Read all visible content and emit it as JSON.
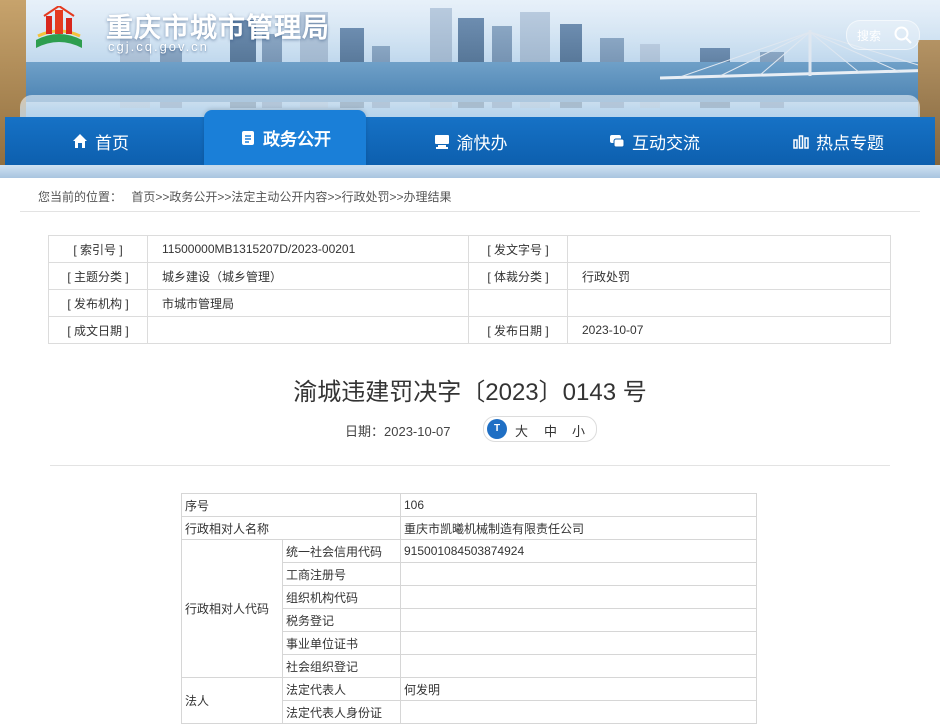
{
  "site": {
    "title": "重庆市城市管理局",
    "url": "cgj.cq.gov.cn",
    "search_label": "搜索"
  },
  "nav": {
    "items": [
      {
        "label": "首页",
        "icon": "home-icon"
      },
      {
        "label": "政务公开",
        "icon": "document-icon",
        "active": true
      },
      {
        "label": "渝快办",
        "icon": "service-desk-icon"
      },
      {
        "label": "互动交流",
        "icon": "chat-icon"
      },
      {
        "label": "热点专题",
        "icon": "topics-icon"
      }
    ]
  },
  "breadcrumb": {
    "prefix": "您当前的位置：",
    "items": [
      "首页",
      "政务公开",
      "法定主动公开内容",
      "行政处罚",
      "办理结果"
    ],
    "separator": ">>"
  },
  "meta": {
    "index_no_label": "[ 索引号 ]",
    "index_no": "11500000MB1315207D/2023-00201",
    "doc_no_label": "[ 发文字号 ]",
    "doc_no": "",
    "topic_label": "[ 主题分类 ]",
    "topic": "城乡建设（城乡管理）",
    "genre_label": "[ 体裁分类 ]",
    "genre": "行政处罚",
    "issuer_label": "[ 发布机构 ]",
    "issuer": "市城市管理局",
    "written_label": "[ 成文日期 ]",
    "written_date": "",
    "publish_label": "[ 发布日期 ]",
    "publish_date": "2023-10-07"
  },
  "article": {
    "title": "渝城违建罚决字〔2023〕0143 号",
    "date_label": "日期：2023-10-07",
    "font_sizes": {
      "badge": "T",
      "large": "大",
      "medium": "中",
      "small": "小"
    }
  },
  "record": {
    "serial_label": "序号",
    "serial": "106",
    "party_name_label": "行政相对人名称",
    "party_name": "重庆市凯曦机械制造有限责任公司",
    "party_code_label": "行政相对人代码",
    "codes": [
      {
        "label": "统一社会信用代码",
        "value": "915001084503874924"
      },
      {
        "label": "工商注册号",
        "value": ""
      },
      {
        "label": "组织机构代码",
        "value": ""
      },
      {
        "label": "税务登记",
        "value": ""
      },
      {
        "label": "事业单位证书",
        "value": ""
      },
      {
        "label": "社会组织登记",
        "value": ""
      }
    ],
    "legal_label": "法人",
    "legal_rows": [
      {
        "label": "法定代表人",
        "value": "何发明"
      },
      {
        "label": "法定代表人身份证",
        "value": ""
      }
    ]
  },
  "colors": {
    "nav_blue": "#0d5fae",
    "nav_active": "#1a7fd8",
    "badge_blue": "#1f6fc4"
  }
}
